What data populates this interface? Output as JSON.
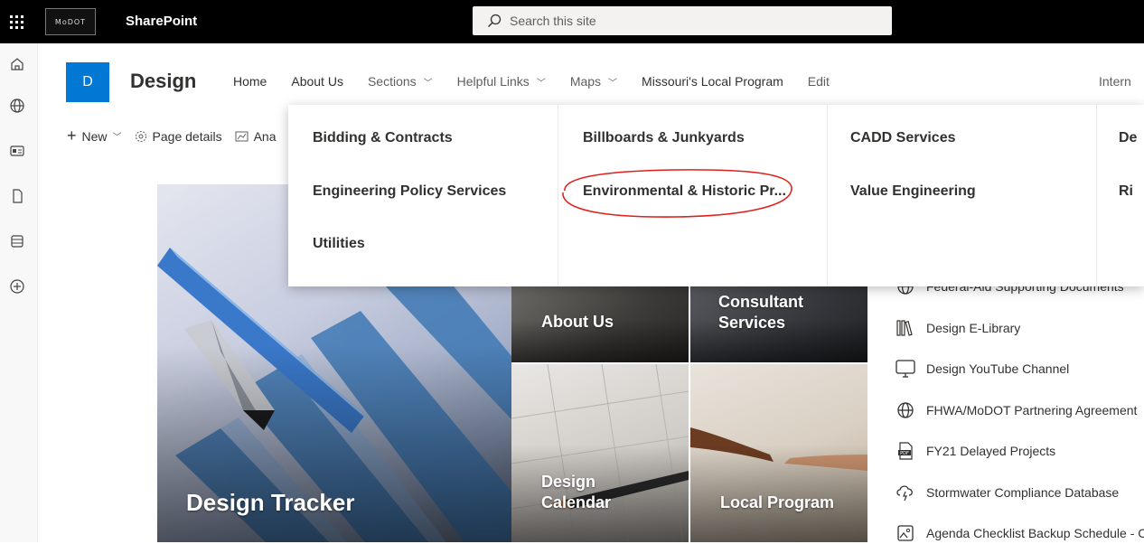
{
  "suitebar": {
    "app_title": "SharePoint",
    "logo_text": "MoDOT",
    "search_placeholder": "Search this site"
  },
  "site": {
    "logo_letter": "D",
    "title": "Design"
  },
  "nav": {
    "items": [
      {
        "label": "Home",
        "has_menu": false
      },
      {
        "label": "About Us",
        "has_menu": false
      },
      {
        "label": "Sections",
        "has_menu": true
      },
      {
        "label": "Helpful Links",
        "has_menu": true
      },
      {
        "label": "Maps",
        "has_menu": true
      },
      {
        "label": "Missouri's Local Program",
        "has_menu": false
      }
    ],
    "edit_label": "Edit",
    "right_cut_label": "Intern"
  },
  "command_bar": {
    "new_label": "New",
    "page_details_label": "Page details",
    "analytics_label": "Ana"
  },
  "mega_menu": {
    "col1": [
      "Bidding & Contracts",
      "Engineering Policy Services",
      "Utilities"
    ],
    "col2": [
      "Billboards & Junkyards",
      "Environmental & Historic Pr..."
    ],
    "col3": [
      "CADD Services",
      "Value Engineering"
    ],
    "col4": [
      "De",
      "Ri"
    ]
  },
  "tiles": {
    "big": "Design Tracker",
    "about": "About Us",
    "consultant_line1": "Consultant",
    "consultant_line2": "Services",
    "calendar_line1": "Design",
    "calendar_line2": "Calendar",
    "local": "Local Program"
  },
  "quick_links": [
    {
      "label": "Federal-Aid Supporting Documents",
      "icon": "globe-icon"
    },
    {
      "label": "Design E-Library",
      "icon": "library-icon"
    },
    {
      "label": "Design YouTube Channel",
      "icon": "monitor-icon"
    },
    {
      "label": "FHWA/MoDOT Partnering Agreement",
      "icon": "globe-icon"
    },
    {
      "label": "FY21 Delayed Projects",
      "icon": "pdf-icon"
    },
    {
      "label": "Stormwater Compliance Database",
      "icon": "cloud-icon"
    },
    {
      "label": "Agenda Checklist Backup Schedule - C",
      "icon": "image-icon"
    }
  ],
  "colors": {
    "suite_bar": "#000000",
    "site_logo": "#0078d4",
    "annotation_circle": "#e0201b"
  }
}
